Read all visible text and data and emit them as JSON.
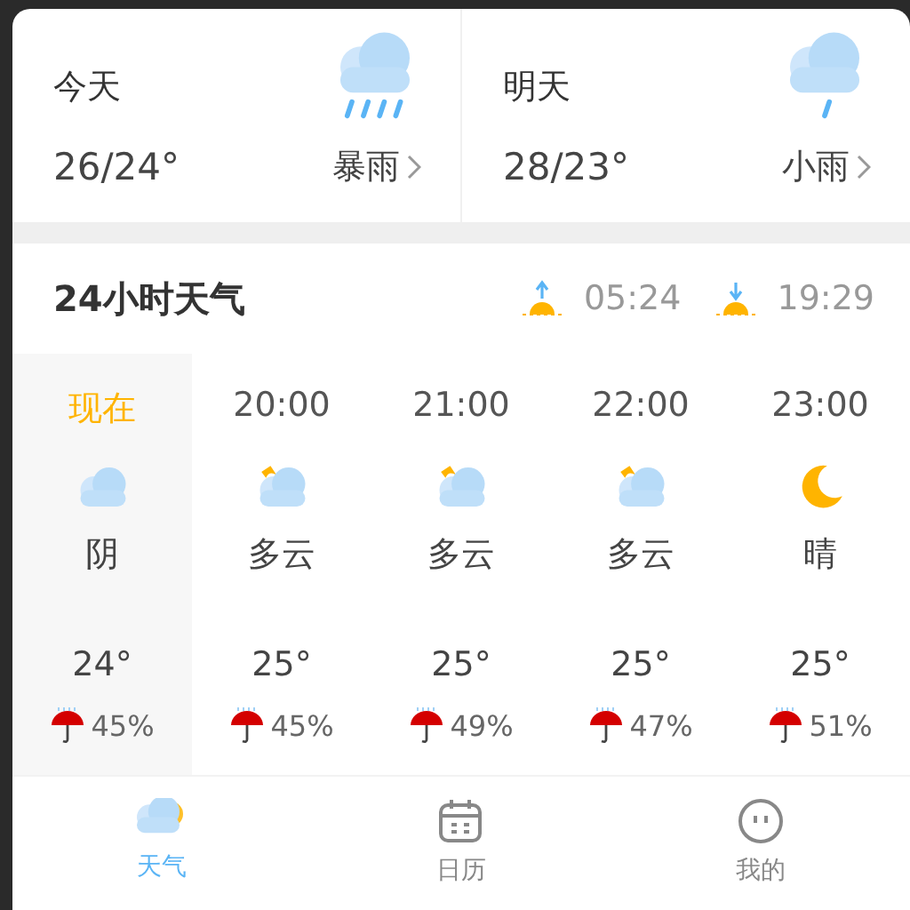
{
  "days": [
    {
      "label": "今天",
      "temp": "26/24°",
      "condition": "暴雨",
      "kind": "heavy-rain"
    },
    {
      "label": "明天",
      "temp": "28/23°",
      "condition": "小雨",
      "kind": "light-rain"
    }
  ],
  "hourly": {
    "title": "24小时天气",
    "sunrise": "05:24",
    "sunset": "19:29",
    "hours": [
      {
        "time": "现在",
        "kind": "overcast",
        "condition": "阴",
        "temp": "24°",
        "rain": "45%",
        "selected": true
      },
      {
        "time": "20:00",
        "kind": "cloudy-night",
        "condition": "多云",
        "temp": "25°",
        "rain": "45%",
        "selected": false
      },
      {
        "time": "21:00",
        "kind": "cloudy-night",
        "condition": "多云",
        "temp": "25°",
        "rain": "49%",
        "selected": false
      },
      {
        "time": "22:00",
        "kind": "cloudy-night",
        "condition": "多云",
        "temp": "25°",
        "rain": "47%",
        "selected": false
      },
      {
        "time": "23:00",
        "kind": "clear-night",
        "condition": "晴",
        "temp": "25°",
        "rain": "51%",
        "selected": false
      }
    ]
  },
  "nav": [
    {
      "label": "天气",
      "kind": "weather",
      "selected": true
    },
    {
      "label": "日历",
      "kind": "calendar",
      "selected": false
    },
    {
      "label": "我的",
      "kind": "profile",
      "selected": false
    }
  ]
}
